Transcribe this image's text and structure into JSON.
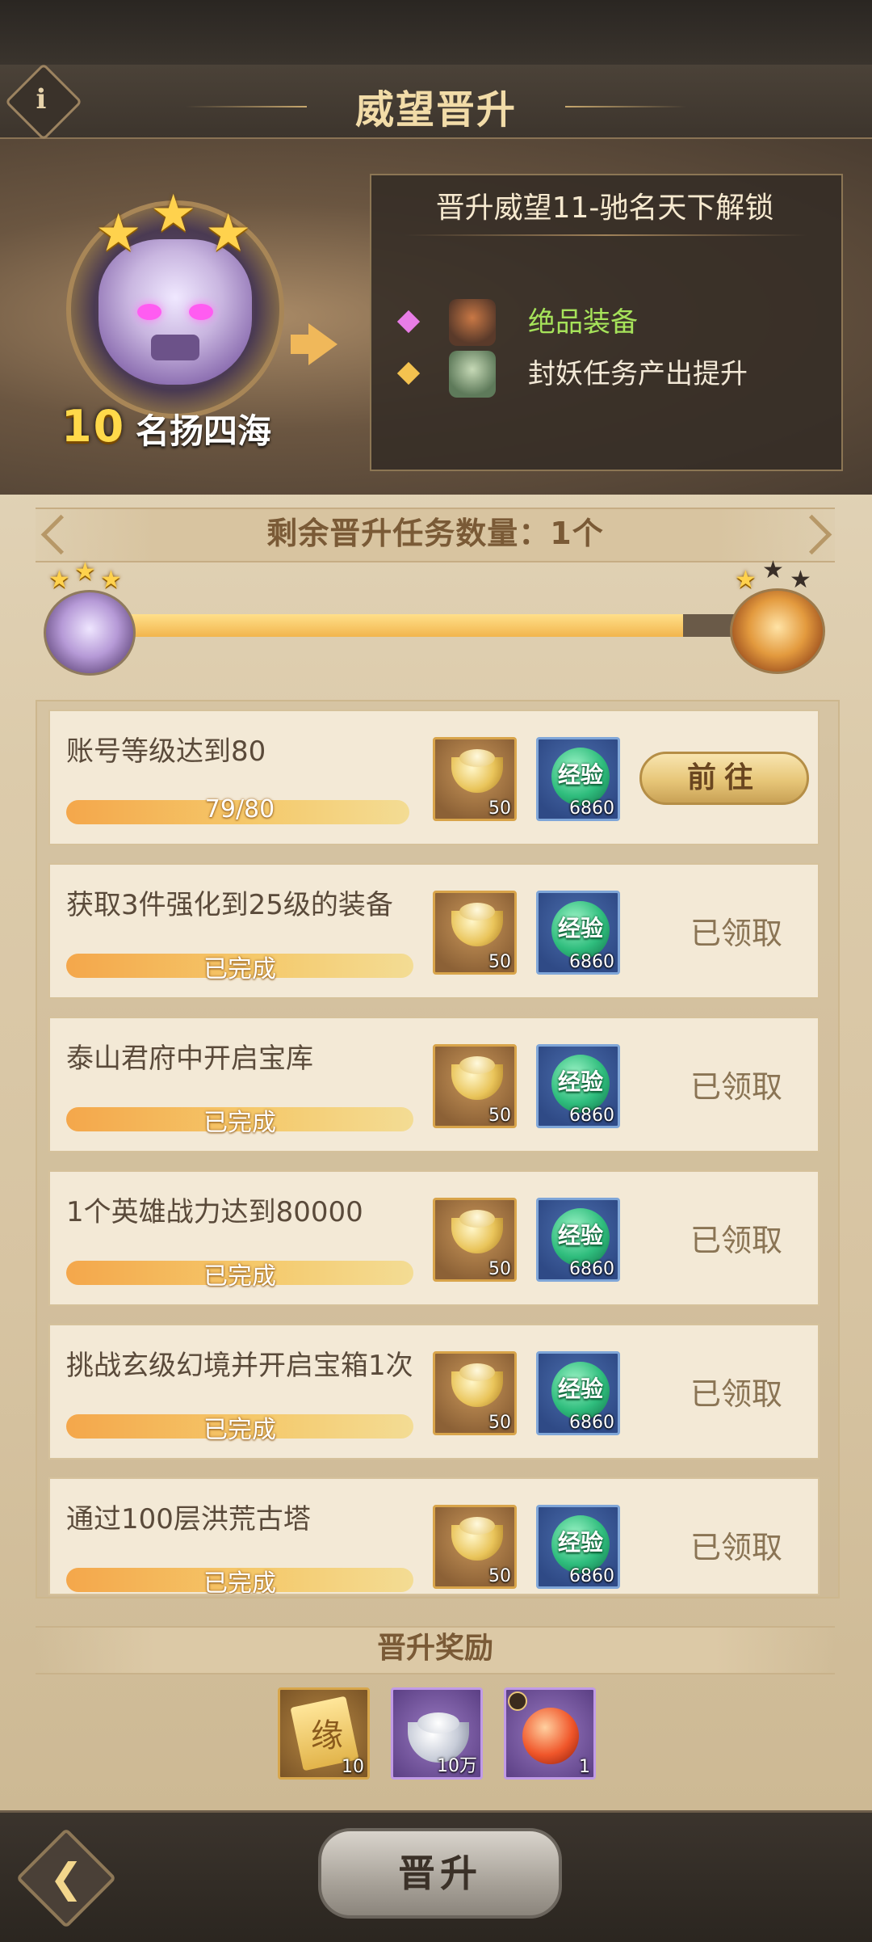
{
  "header": {
    "title": "威望晋升",
    "info_label": "i"
  },
  "current_rank": {
    "level": "10",
    "name": "名扬四海"
  },
  "unlock": {
    "title": "晋升威望11-驰名天下解锁",
    "items": [
      {
        "text": "绝品装备",
        "bullet_color": "#e87de6",
        "text_color": "#a6e35a"
      },
      {
        "text": "封妖任务产出提升",
        "bullet_color": "#f3c24f",
        "text_color": "#f2e8d6"
      }
    ]
  },
  "task_count": {
    "label": "剩余晋升任务数量：1个"
  },
  "progress": {
    "fraction": 0.87
  },
  "tasks": [
    {
      "name": "账号等级达到80",
      "bar_text": "79/80",
      "progress": 0.9875,
      "gold_qty": "50",
      "exp_label": "经验",
      "exp_qty": "6860",
      "action": "前往",
      "state": "go"
    },
    {
      "name": "获取3件强化到25级的装备",
      "bar_text": "已完成",
      "progress": 1,
      "gold_qty": "50",
      "exp_label": "经验",
      "exp_qty": "6860",
      "action": "已领取",
      "state": "claimed"
    },
    {
      "name": "泰山君府中开启宝库",
      "bar_text": "已完成",
      "progress": 1,
      "gold_qty": "50",
      "exp_label": "经验",
      "exp_qty": "6860",
      "action": "已领取",
      "state": "claimed"
    },
    {
      "name": "1个英雄战力达到80000",
      "bar_text": "已完成",
      "progress": 1,
      "gold_qty": "50",
      "exp_label": "经验",
      "exp_qty": "6860",
      "action": "已领取",
      "state": "claimed"
    },
    {
      "name": "挑战玄级幻境并开启宝箱1次",
      "bar_text": "已完成",
      "progress": 1,
      "gold_qty": "50",
      "exp_label": "经验",
      "exp_qty": "6860",
      "action": "已领取",
      "state": "claimed"
    },
    {
      "name": "通过100层洪荒古塔",
      "bar_text": "已完成",
      "progress": 1,
      "gold_qty": "50",
      "exp_label": "经验",
      "exp_qty": "6860",
      "action": "已领取",
      "state": "claimed"
    }
  ],
  "rewards": {
    "title": "晋升奖励",
    "items": [
      {
        "icon": "fate-scroll-icon",
        "glyph": "缘",
        "qty": "10"
      },
      {
        "icon": "silver-ingot-icon",
        "qty": "10万"
      },
      {
        "icon": "fire-orb-icon",
        "qty": "1"
      }
    ]
  },
  "footer": {
    "back_glyph": "❮",
    "promote_label": "晋升"
  }
}
